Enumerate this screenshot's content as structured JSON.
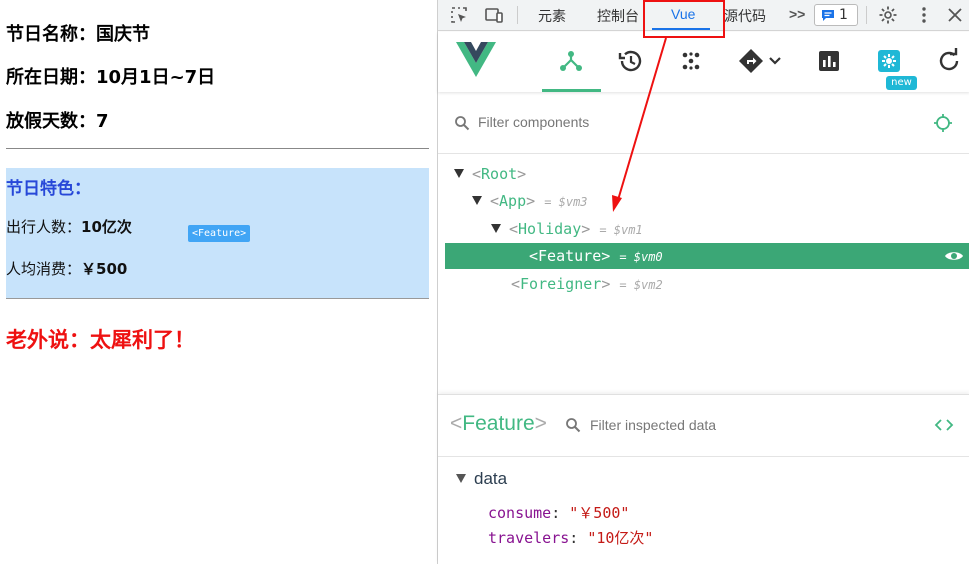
{
  "page": {
    "name_label": "节日名称：",
    "name_value": "国庆节",
    "date_label": "所在日期：",
    "date_value": "10月1日~7日",
    "days_label": "放假天数：",
    "days_value": "7",
    "feature": {
      "title": "节日特色：",
      "travelers_label": "出行人数：",
      "travelers_value": "10亿次",
      "consume_label": "人均消费：",
      "consume_value": "￥500",
      "hover_tag": "<Feature>"
    },
    "foreigner_saying": "老外说：太犀利了！"
  },
  "devtools": {
    "tabs": [
      "元素",
      "控制台",
      "Vue",
      "源代码"
    ],
    "active_tab": "Vue",
    "more_tabs": ">>",
    "issues_count": "1",
    "vue_toolbar": {
      "new_badge": "new"
    },
    "filter_placeholder": "Filter components",
    "tree": [
      {
        "name": "Root",
        "vm": ""
      },
      {
        "name": "App",
        "vm": "= $vm3"
      },
      {
        "name": "Holiday",
        "vm": "= $vm1"
      },
      {
        "name": "Feature",
        "vm": "= $vm0",
        "selected": true
      },
      {
        "name": "Foreigner",
        "vm": "= $vm2"
      }
    ],
    "inspector": {
      "component": "Feature",
      "filter_placeholder": "Filter inspected data",
      "section": "data",
      "props": [
        {
          "key": "consume",
          "value": "\"￥500\""
        },
        {
          "key": "travelers",
          "value": "\"10亿次\""
        }
      ]
    },
    "colors": {
      "vue_green": "#42b883",
      "selected_row": "#3ba776",
      "highlight_box": "#ee1111",
      "feature_bg": "#c7e3fb"
    }
  }
}
